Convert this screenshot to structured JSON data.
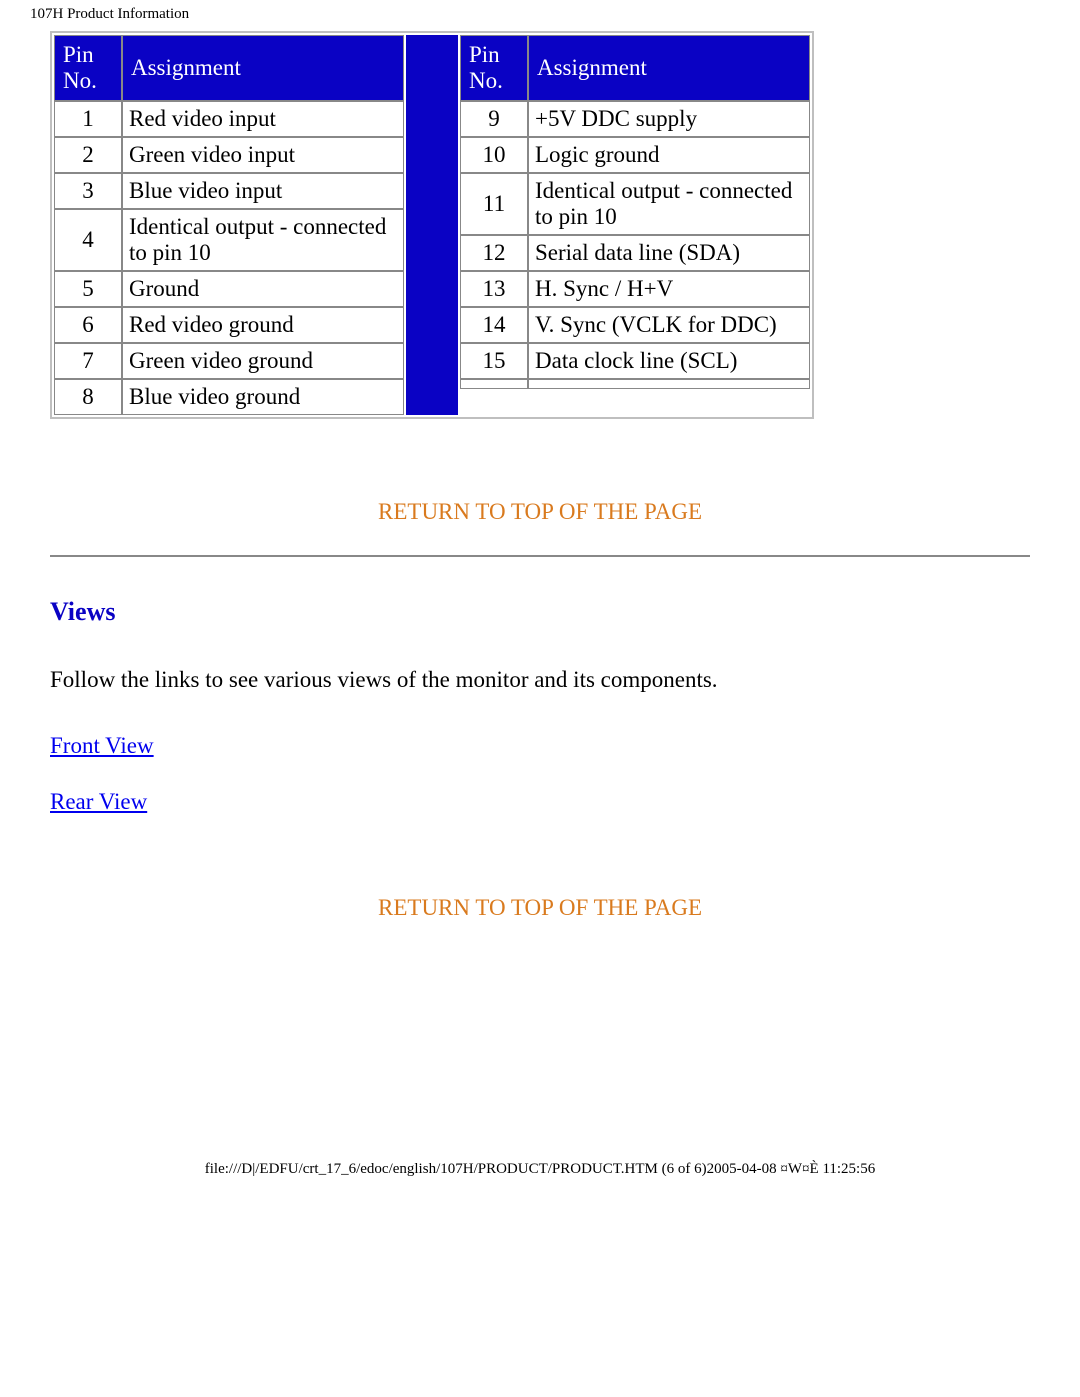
{
  "header": {
    "title": "107H Product Information"
  },
  "pin_table": {
    "headers": {
      "pin": "Pin No.",
      "assign": "Assignment"
    },
    "left": [
      {
        "pin": "1",
        "assign": "Red video input"
      },
      {
        "pin": "2",
        "assign": "Green video input"
      },
      {
        "pin": "3",
        "assign": "Blue video input"
      },
      {
        "pin": "4",
        "assign": "Identical output - connected to pin 10"
      },
      {
        "pin": "5",
        "assign": "Ground"
      },
      {
        "pin": "6",
        "assign": "Red video ground"
      },
      {
        "pin": "7",
        "assign": "Green video ground"
      },
      {
        "pin": "8",
        "assign": "Blue video ground"
      }
    ],
    "right": [
      {
        "pin": "9",
        "assign": "+5V DDC supply"
      },
      {
        "pin": "10",
        "assign": "Logic ground"
      },
      {
        "pin": "11",
        "assign": "Identical output - connected to pin 10"
      },
      {
        "pin": "12",
        "assign": "Serial data line (SDA)"
      },
      {
        "pin": "13",
        "assign": "H. Sync / H+V"
      },
      {
        "pin": "14",
        "assign": "V. Sync (VCLK for DDC)"
      },
      {
        "pin": "15",
        "assign": "Data clock line (SCL)"
      },
      {
        "pin": "",
        "assign": ""
      }
    ]
  },
  "links": {
    "return_top": "RETURN TO TOP OF THE PAGE",
    "front_view": "Front View",
    "rear_view": "Rear View"
  },
  "views": {
    "heading": "Views",
    "desc": "Follow the links to see various views of the monitor and its components."
  },
  "footer": {
    "text": "file:///D|/EDFU/crt_17_6/edoc/english/107H/PRODUCT/PRODUCT.HTM (6 of 6)2005-04-08 ¤W¤È 11:25:56"
  }
}
